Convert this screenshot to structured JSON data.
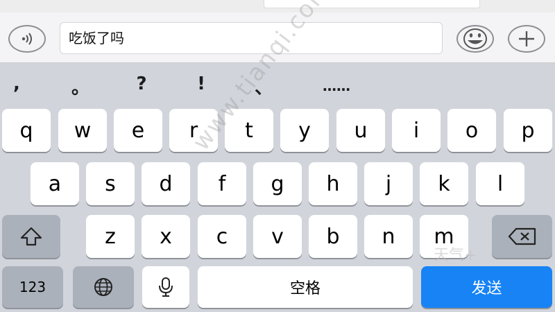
{
  "input": {
    "value": "吃饭了吗"
  },
  "punctuation": [
    ",",
    "。",
    "?",
    "!",
    "、",
    "……"
  ],
  "keyboard": {
    "row1": [
      "q",
      "w",
      "e",
      "r",
      "t",
      "y",
      "u",
      "i",
      "o",
      "p"
    ],
    "row2": [
      "a",
      "s",
      "d",
      "f",
      "g",
      "h",
      "j",
      "k",
      "l"
    ],
    "row3": [
      "z",
      "x",
      "c",
      "v",
      "b",
      "n",
      "m"
    ],
    "numbers_label": "123",
    "space_label": "空格",
    "send_label": "发送"
  },
  "icons": {
    "voice": "voice-wave-icon",
    "emoji": "emoji-icon",
    "plus": "plus-icon",
    "shift": "shift-arrow-icon",
    "delete": "backspace-icon",
    "globe": "globe-icon",
    "mic": "microphone-icon"
  },
  "colors": {
    "keyboard_bg": "#d1d5db",
    "send_button": "#1783f5",
    "function_key": "#abb1ba"
  },
  "watermark": {
    "text": "www.tianqi.com",
    "brand": "天气+"
  }
}
